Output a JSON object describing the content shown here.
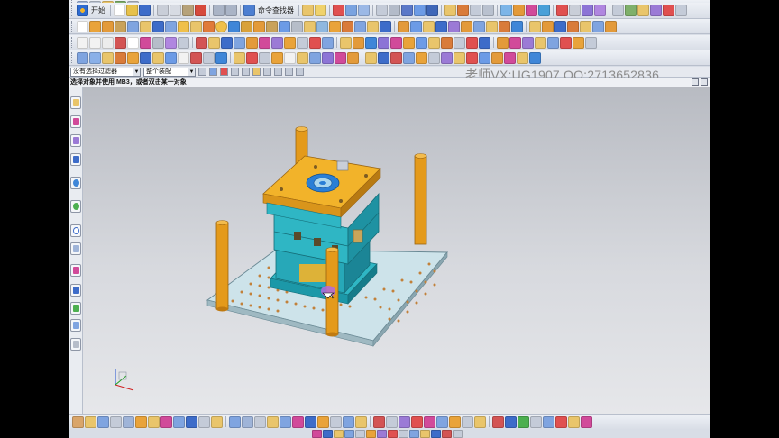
{
  "app": {
    "watermark": "老师VX:UG1907   QQ:2713652836",
    "start_label": "开始",
    "command_finder_label": "命令查找器",
    "cue_line": "选择对象并使用 MB3，或者双击某一对象"
  },
  "selection_bar": {
    "filter_value": "没有选择过滤器",
    "assembly_value": "整个装配"
  },
  "colors": {
    "accent_blue": "#2d6bd1",
    "mold_plate_top": "#f2b32a",
    "mold_plate_body": "#2fb6c4",
    "pillar_orange": "#e49a1b",
    "base_plate": "#cfe3ea"
  },
  "resource_bar": {
    "icons": [
      "part-navigator-icon",
      "assembly-navigator-icon",
      "constraint-navigator-icon",
      "part-library-icon",
      "reuse-library-icon",
      "history-icon",
      "web-browser-icon",
      "roles-icon",
      "system-materials-icon",
      "process-studio-icon",
      "manufacturing-wizard-icon",
      "mold-wizard-icon",
      "hd3d-tools-icon",
      "palette-icon"
    ]
  }
}
